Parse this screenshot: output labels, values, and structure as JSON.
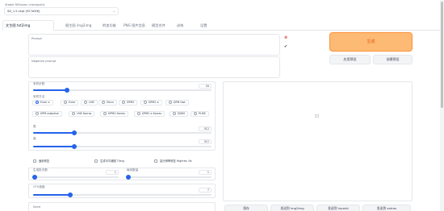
{
  "checkpoint": {
    "label": "Stable Diffusion checkpoint",
    "value": "SD_1.5.ckpt [927b5f6]"
  },
  "tabs": [
    "文生图 txt2img",
    "图生图 img2img",
    "附加功能",
    "PNG 图片信息",
    "模型合并",
    "训练",
    "设置"
  ],
  "prompt": {
    "placeholder": "Prompt",
    "negative_placeholder": "Negative prompt"
  },
  "prompt_tools": {
    "clear_icon": "trash-icon",
    "apply_icon": "check-icon"
  },
  "actions": {
    "generate": "生成",
    "apply_style": "应用预设",
    "create_style": "创建预设"
  },
  "sampling_steps": {
    "label": "采样步数",
    "value": "20",
    "fraction": 0.19
  },
  "sampler": {
    "label": "采样方法",
    "options_row1": [
      "Euler a",
      "Euler",
      "LMS",
      "Heun",
      "DPM2",
      "DPM2 a",
      "DPM fast"
    ],
    "options_row2": [
      "DPM adaptive",
      "LMS Karras",
      "DPM2 Karras",
      "DPM2 a Karras",
      "DDIM",
      "PLMS"
    ],
    "selected": "Euler a"
  },
  "width": {
    "label": "宽",
    "value": "512",
    "fraction": 0.23
  },
  "height": {
    "label": "高",
    "value": "512",
    "fraction": 0.23
  },
  "checkboxes": [
    "面部修复",
    "生成可平铺图 Tiling",
    "高分辨率修复 Highres. fix"
  ],
  "batch_count": {
    "label": "生成批次数",
    "value": "1",
    "fraction": 0.02
  },
  "batch_size": {
    "label": "每批数量",
    "value": "1",
    "fraction": 0.02
  },
  "cfg": {
    "label": "CFG强度",
    "value": "7",
    "fraction": 0.21
  },
  "seed": {
    "label": "Seed"
  },
  "output": {
    "image_icon": "image-icon",
    "buttons": [
      "保存",
      "发送到 img2img",
      "发送到 inpaint",
      "发送到 extras"
    ]
  },
  "colors": {
    "accent": "#2563eb",
    "generate_bg": "#fdba74",
    "generate_text": "#ea580c"
  }
}
